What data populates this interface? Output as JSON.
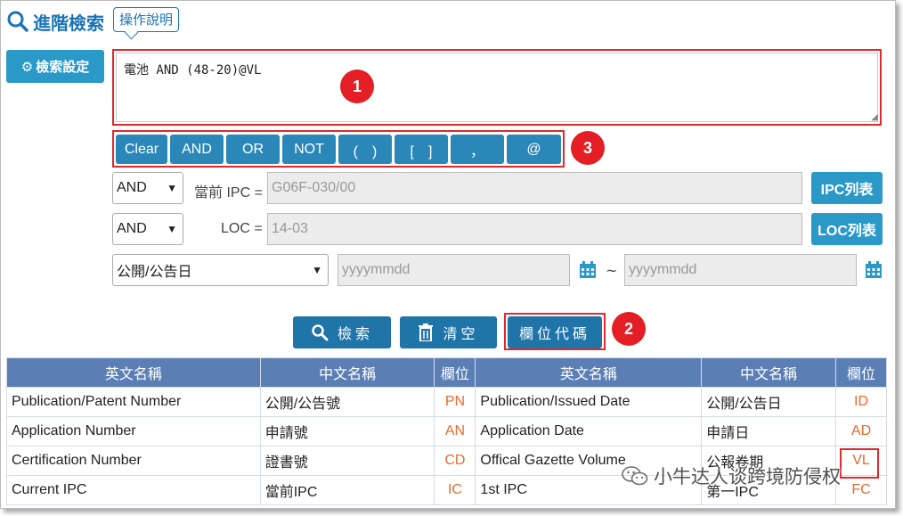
{
  "header": {
    "title": "進階檢索",
    "help_label": "操作說明"
  },
  "settings": {
    "label": "檢索設定"
  },
  "query": {
    "value": "電池 AND (48-20)@VL"
  },
  "badges": {
    "b1": "1",
    "b2": "2",
    "b3": "3"
  },
  "operators": [
    "Clear",
    "AND",
    "OR",
    "NOT",
    "(　)",
    "[　]",
    "，",
    "@"
  ],
  "ipc_row": {
    "operator": "AND",
    "label": "當前 IPC =",
    "placeholder": "G06F-030/00",
    "button": "IPC列表"
  },
  "loc_row": {
    "operator": "AND",
    "label": "LOC =",
    "placeholder": "14-03",
    "button": "LOC列表"
  },
  "date_row": {
    "field": "公開/公告日",
    "from_placeholder": "yyyymmdd",
    "tilde": "~",
    "to_placeholder": "yyyymmdd"
  },
  "actions": {
    "search": "檢索",
    "clear": "清空",
    "codes": "欄位代碼"
  },
  "table": {
    "headers": [
      "英文名稱",
      "中文名稱",
      "欄位",
      "英文名稱",
      "中文名稱",
      "欄位"
    ],
    "rows": [
      [
        "Publication/Patent Number",
        "公開/公告號",
        "PN",
        "Publication/Issued Date",
        "公開/公告日",
        "ID"
      ],
      [
        "Application Number",
        "申請號",
        "AN",
        "Application Date",
        "申請日",
        "AD"
      ],
      [
        "Certification Number",
        "證書號",
        "CD",
        "Offical Gazette Volume",
        "公報卷期",
        "VL"
      ],
      [
        "Current IPC",
        "當前IPC",
        "IC",
        "1st IPC",
        "第一IPC",
        "FC"
      ]
    ]
  },
  "watermark": {
    "text": "小牛达人谈跨境防侵权"
  },
  "colors": {
    "accent": "#1a73b5",
    "button": "#2a87b8",
    "highlight": "#e0282d",
    "code": "#e86a2c",
    "table_header": "#5b7fb5"
  }
}
